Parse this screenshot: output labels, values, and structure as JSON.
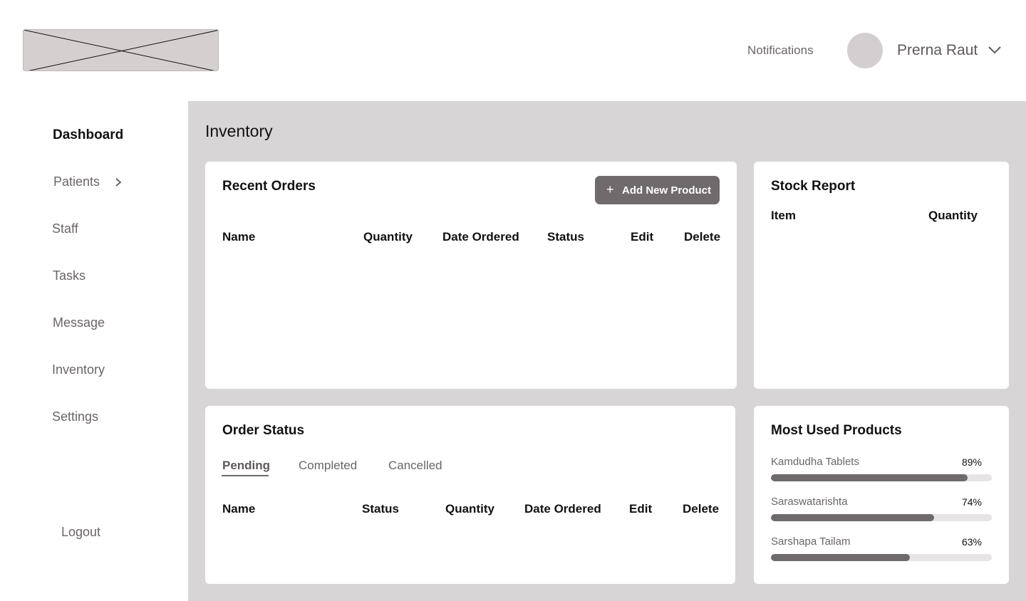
{
  "header": {
    "notifications_label": "Notifications",
    "user_name": "Prerna Raut"
  },
  "sidebar": {
    "items": [
      {
        "label": "Dashboard"
      },
      {
        "label": "Patients"
      },
      {
        "label": "Staff"
      },
      {
        "label": "Tasks"
      },
      {
        "label": "Message"
      },
      {
        "label": "Inventory"
      },
      {
        "label": "Settings"
      }
    ],
    "logout_label": "Logout"
  },
  "page": {
    "title": "Inventory"
  },
  "recent_orders": {
    "title": "Recent Orders",
    "add_button_label": "Add New Product",
    "columns": [
      "Name",
      "Quantity",
      "Date Ordered",
      "Status",
      "Edit",
      "Delete"
    ]
  },
  "stock_report": {
    "title": "Stock Report",
    "columns": [
      "Item",
      "Quantity"
    ]
  },
  "order_status": {
    "title": "Order Status",
    "tabs": [
      "Pending",
      "Completed",
      "Cancelled"
    ],
    "active_tab": "Pending",
    "columns": [
      "Name",
      "Status",
      "Quantity",
      "Date Ordered",
      "Edit",
      "Delete"
    ]
  },
  "most_used": {
    "title": "Most Used Products",
    "products": [
      {
        "name": "Kamdudha Tablets",
        "percent_label": "89%",
        "percent": 89
      },
      {
        "name": "Saraswatarishta",
        "percent_label": "74%",
        "percent": 74
      },
      {
        "name": "Sarshapa Tailam",
        "percent_label": "63%",
        "percent": 63
      }
    ]
  },
  "colors": {
    "accent": "#6f6a6c",
    "main_background": "#d8d5d6",
    "placeholder": "#d5d0d0"
  }
}
